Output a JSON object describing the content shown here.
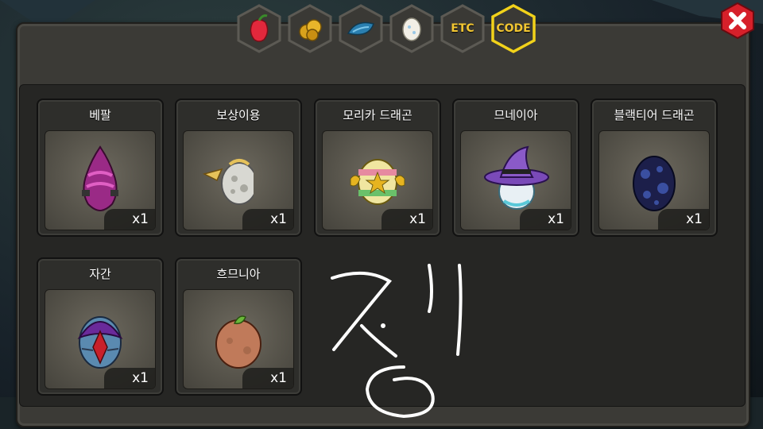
{
  "tabs": [
    {
      "name": "fruit",
      "icon": "fruit-icon",
      "label": ""
    },
    {
      "name": "gold",
      "icon": "gold-icon",
      "label": ""
    },
    {
      "name": "scale",
      "icon": "scale-icon",
      "label": ""
    },
    {
      "name": "egg",
      "icon": "egg-icon",
      "label": ""
    },
    {
      "name": "etc",
      "icon": "",
      "label": "ETC"
    },
    {
      "name": "code",
      "icon": "",
      "label": "CODE",
      "selected": true
    }
  ],
  "items": [
    {
      "title": "베팔",
      "qty": "x1",
      "icon": "pink-egg-icon"
    },
    {
      "title": "보상이용",
      "qty": "x1",
      "icon": "winged-moon-egg-icon"
    },
    {
      "title": "모리카 드래곤",
      "qty": "x1",
      "icon": "star-egg-icon"
    },
    {
      "title": "므네이아",
      "qty": "x1",
      "icon": "witch-hat-egg-icon"
    },
    {
      "title": "블랙티어 드래곤",
      "qty": "x1",
      "icon": "dark-spotted-egg-icon"
    },
    {
      "title": "자간",
      "qty": "x1",
      "icon": "armored-egg-icon"
    },
    {
      "title": "흐므니아",
      "qty": "x1",
      "icon": "sprout-egg-icon"
    }
  ],
  "colors": {
    "selected_tab_border": "#f2d21a",
    "tab_label": "#f2c632",
    "close_button": "#d6202a"
  }
}
